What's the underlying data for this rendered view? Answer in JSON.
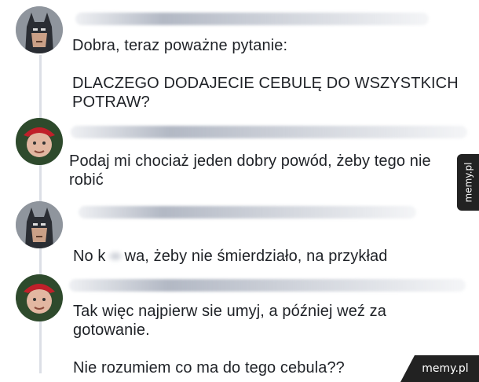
{
  "watermark": {
    "side": "memy.pl",
    "corner": "memy.pl"
  },
  "comments": [
    {
      "author_icon": "batman-avatar",
      "lines": "Dobra, teraz poważne pytanie:\n\nDLACZEGO DODAJECIE CEBULĘ DO WSZYSTKICH\nPOTRAW?"
    },
    {
      "author_icon": "elf-avatar",
      "lines": "Podaj mi chociaż jeden dobry powód, żeby tego nie\nrobić"
    },
    {
      "author_icon": "batman-avatar",
      "prefix": "No k",
      "suffix": "wa, żeby nie śmierdziało, na przykład"
    },
    {
      "author_icon": "elf-avatar",
      "lines": "Tak więc najpierw sie umyj, a później weź za\ngotowanie.\n\nNie rozumiem co ma do tego cebula??"
    }
  ]
}
